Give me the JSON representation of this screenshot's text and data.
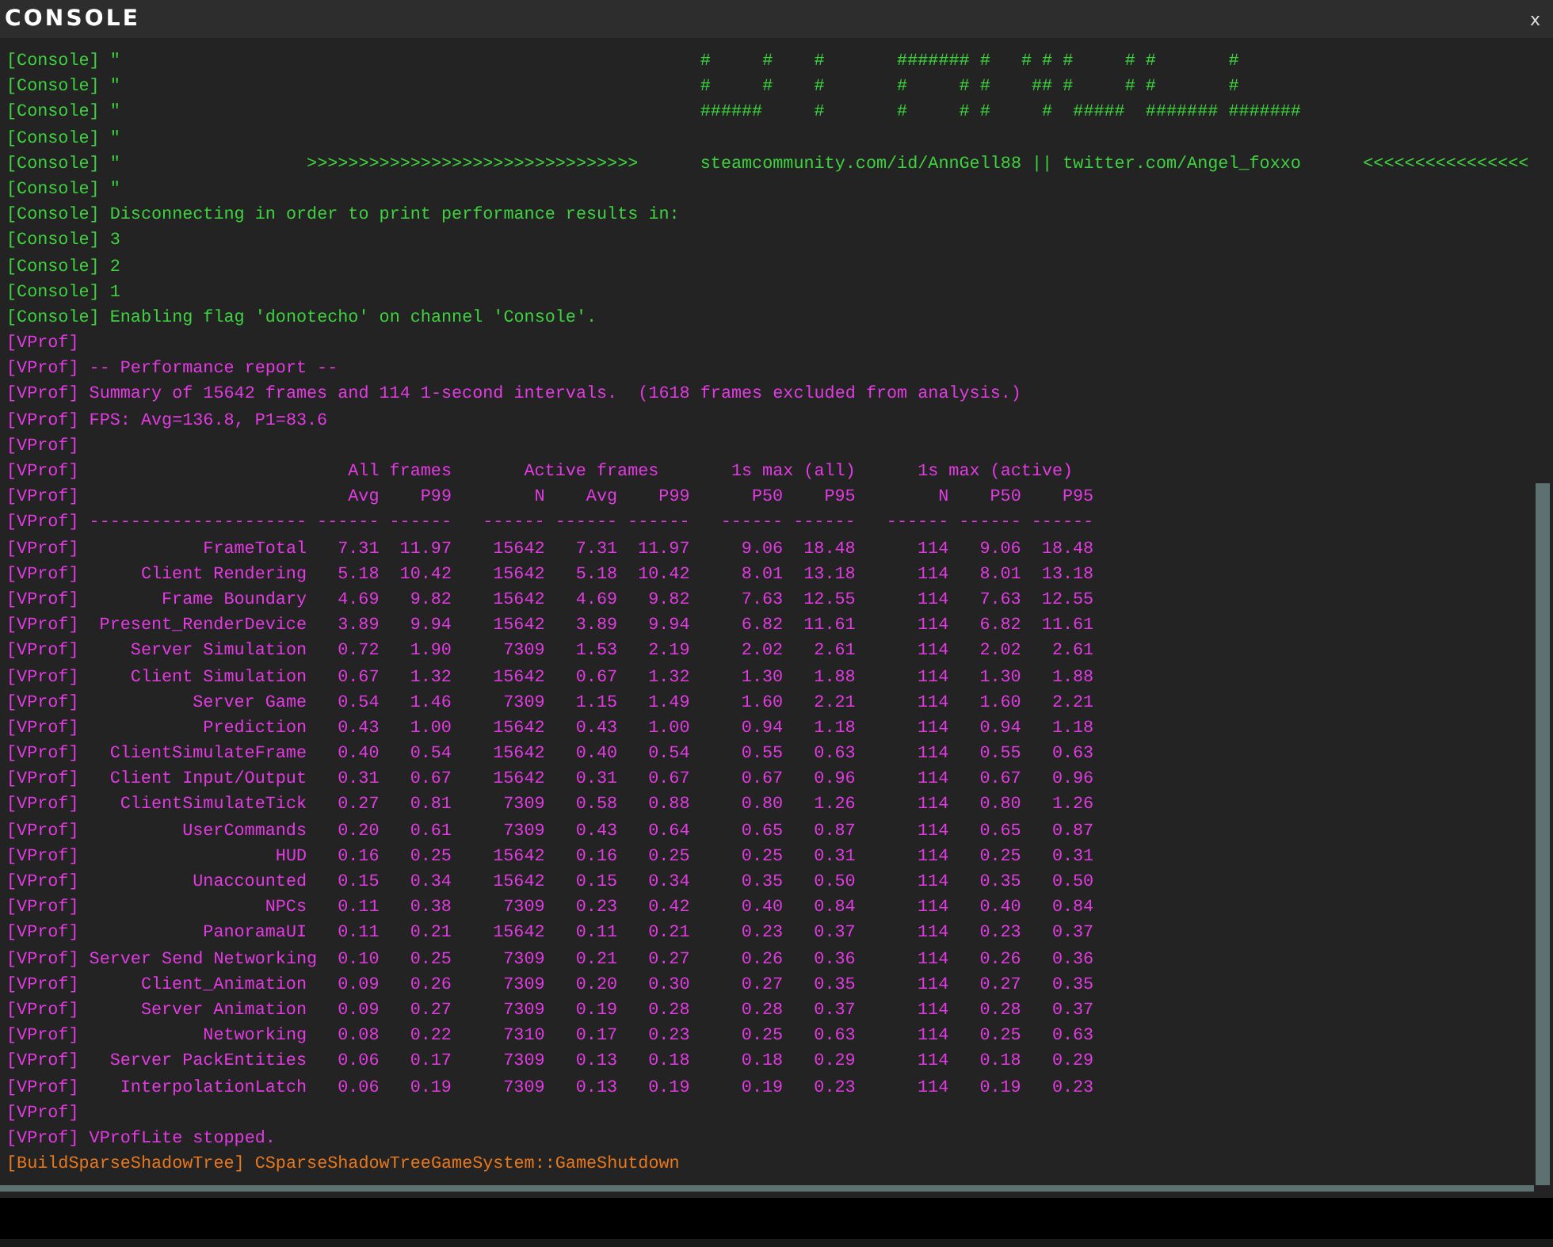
{
  "window": {
    "title": "CONSOLE",
    "close": "x"
  },
  "log": [
    {
      "kind": "text",
      "channel": "[Console]",
      "color": "#3fd23f",
      "text": "\"                                                        #     #    #       ####### #   # # #     # #       #"
    },
    {
      "kind": "text",
      "channel": "[Console]",
      "color": "#3fd23f",
      "text": "\"                                                        #     #    #       #     # #    ## #     # #       #"
    },
    {
      "kind": "text",
      "channel": "[Console]",
      "color": "#3fd23f",
      "text": "\"                                                        ######     #       #     # #     #  #####  ####### #######"
    },
    {
      "kind": "text",
      "channel": "[Console]",
      "color": "#3fd23f",
      "text": "\""
    },
    {
      "kind": "text",
      "channel": "[Console]",
      "color": "#3fd23f",
      "text": "\"                  >>>>>>>>>>>>>>>>>>>>>>>>>>>>>>>>      steamcommunity.com/id/AnnGell88 || twitter.com/Angel_foxxo      <<<<<<<<<<<<<<<<"
    },
    {
      "kind": "text",
      "channel": "[Console]",
      "color": "#3fd23f",
      "text": "\""
    },
    {
      "kind": "text",
      "channel": "[Console]",
      "color": "#3fd23f",
      "text": "Disconnecting in order to print performance results in:"
    },
    {
      "kind": "text",
      "channel": "[Console]",
      "color": "#3fd23f",
      "text": "3"
    },
    {
      "kind": "text",
      "channel": "[Console]",
      "color": "#3fd23f",
      "text": "2"
    },
    {
      "kind": "text",
      "channel": "[Console]",
      "color": "#3fd23f",
      "text": "1"
    },
    {
      "kind": "text",
      "channel": "[Console]",
      "color": "#3fd23f",
      "text": "Enabling flag 'donotecho' on channel 'Console'."
    },
    {
      "kind": "text",
      "channel": "[VProf]",
      "color": "#e23be2"
    },
    {
      "kind": "text",
      "channel": "[VProf]",
      "color": "#e23be2",
      "text": "-- Performance report --"
    },
    {
      "kind": "text",
      "channel": "[VProf]",
      "color": "#e23be2",
      "text": "Summary of 15642 frames and 114 1-second intervals.  (1618 frames excluded from analysis.)"
    },
    {
      "kind": "text",
      "channel": "[VProf]",
      "color": "#e23be2",
      "text": "FPS: Avg=136.8, P1=83.6"
    },
    {
      "kind": "text",
      "channel": "[VProf]",
      "color": "#e23be2"
    },
    {
      "kind": "groups",
      "channel": "[VProf]",
      "color": "#e23be2",
      "cells": [
        "All frames",
        "Active frames",
        "1s max (all)",
        "1s max (active)"
      ]
    },
    {
      "kind": "columns",
      "channel": "[VProf]",
      "color": "#e23be2",
      "cells": [
        "Avg",
        "P99",
        "N",
        "Avg",
        "P99",
        "P50",
        "P95",
        "N",
        "P50",
        "P95"
      ]
    },
    {
      "kind": "row",
      "channel": "[VProf]",
      "color": "#e23be2",
      "cells": [
        "---------------------",
        "------",
        "------",
        "------",
        "------",
        "------",
        "------",
        "------",
        "------",
        "------",
        "------"
      ]
    },
    {
      "kind": "row",
      "channel": "[VProf]",
      "color": "#e23be2",
      "cells": [
        "FrameTotal",
        "7.31",
        "11.97",
        "15642",
        "7.31",
        "11.97",
        "9.06",
        "18.48",
        "114",
        "9.06",
        "18.48"
      ]
    },
    {
      "kind": "row",
      "channel": "[VProf]",
      "color": "#e23be2",
      "cells": [
        "Client Rendering",
        "5.18",
        "10.42",
        "15642",
        "5.18",
        "10.42",
        "8.01",
        "13.18",
        "114",
        "8.01",
        "13.18"
      ]
    },
    {
      "kind": "row",
      "channel": "[VProf]",
      "color": "#e23be2",
      "cells": [
        "Frame Boundary",
        "4.69",
        "9.82",
        "15642",
        "4.69",
        "9.82",
        "7.63",
        "12.55",
        "114",
        "7.63",
        "12.55"
      ]
    },
    {
      "kind": "row",
      "channel": "[VProf]",
      "color": "#e23be2",
      "cells": [
        "Present_RenderDevice",
        "3.89",
        "9.94",
        "15642",
        "3.89",
        "9.94",
        "6.82",
        "11.61",
        "114",
        "6.82",
        "11.61"
      ]
    },
    {
      "kind": "row",
      "channel": "[VProf]",
      "color": "#e23be2",
      "cells": [
        "Server Simulation",
        "0.72",
        "1.90",
        "7309",
        "1.53",
        "2.19",
        "2.02",
        "2.61",
        "114",
        "2.02",
        "2.61"
      ]
    },
    {
      "kind": "row",
      "channel": "[VProf]",
      "color": "#e23be2",
      "cells": [
        "Client Simulation",
        "0.67",
        "1.32",
        "15642",
        "0.67",
        "1.32",
        "1.30",
        "1.88",
        "114",
        "1.30",
        "1.88"
      ]
    },
    {
      "kind": "row",
      "channel": "[VProf]",
      "color": "#e23be2",
      "cells": [
        "Server Game",
        "0.54",
        "1.46",
        "7309",
        "1.15",
        "1.49",
        "1.60",
        "2.21",
        "114",
        "1.60",
        "2.21"
      ]
    },
    {
      "kind": "row",
      "channel": "[VProf]",
      "color": "#e23be2",
      "cells": [
        "Prediction",
        "0.43",
        "1.00",
        "15642",
        "0.43",
        "1.00",
        "0.94",
        "1.18",
        "114",
        "0.94",
        "1.18"
      ]
    },
    {
      "kind": "row",
      "channel": "[VProf]",
      "color": "#e23be2",
      "cells": [
        "ClientSimulateFrame",
        "0.40",
        "0.54",
        "15642",
        "0.40",
        "0.54",
        "0.55",
        "0.63",
        "114",
        "0.55",
        "0.63"
      ]
    },
    {
      "kind": "row",
      "channel": "[VProf]",
      "color": "#e23be2",
      "cells": [
        "Client Input/Output",
        "0.31",
        "0.67",
        "15642",
        "0.31",
        "0.67",
        "0.67",
        "0.96",
        "114",
        "0.67",
        "0.96"
      ]
    },
    {
      "kind": "row",
      "channel": "[VProf]",
      "color": "#e23be2",
      "cells": [
        "ClientSimulateTick",
        "0.27",
        "0.81",
        "7309",
        "0.58",
        "0.88",
        "0.80",
        "1.26",
        "114",
        "0.80",
        "1.26"
      ]
    },
    {
      "kind": "row",
      "channel": "[VProf]",
      "color": "#e23be2",
      "cells": [
        "UserCommands",
        "0.20",
        "0.61",
        "7309",
        "0.43",
        "0.64",
        "0.65",
        "0.87",
        "114",
        "0.65",
        "0.87"
      ]
    },
    {
      "kind": "row",
      "channel": "[VProf]",
      "color": "#e23be2",
      "cells": [
        "HUD",
        "0.16",
        "0.25",
        "15642",
        "0.16",
        "0.25",
        "0.25",
        "0.31",
        "114",
        "0.25",
        "0.31"
      ]
    },
    {
      "kind": "row",
      "channel": "[VProf]",
      "color": "#e23be2",
      "cells": [
        "Unaccounted",
        "0.15",
        "0.34",
        "15642",
        "0.15",
        "0.34",
        "0.35",
        "0.50",
        "114",
        "0.35",
        "0.50"
      ]
    },
    {
      "kind": "row",
      "channel": "[VProf]",
      "color": "#e23be2",
      "cells": [
        "NPCs",
        "0.11",
        "0.38",
        "7309",
        "0.23",
        "0.42",
        "0.40",
        "0.84",
        "114",
        "0.40",
        "0.84"
      ]
    },
    {
      "kind": "row",
      "channel": "[VProf]",
      "color": "#e23be2",
      "cells": [
        "PanoramaUI",
        "0.11",
        "0.21",
        "15642",
        "0.11",
        "0.21",
        "0.23",
        "0.37",
        "114",
        "0.23",
        "0.37"
      ]
    },
    {
      "kind": "row",
      "channel": "[VProf]",
      "color": "#e23be2",
      "cells": [
        "Server Send Networking",
        "0.10",
        "0.25",
        "7309",
        "0.21",
        "0.27",
        "0.26",
        "0.36",
        "114",
        "0.26",
        "0.36"
      ]
    },
    {
      "kind": "row",
      "channel": "[VProf]",
      "color": "#e23be2",
      "cells": [
        "Client_Animation",
        "0.09",
        "0.26",
        "7309",
        "0.20",
        "0.30",
        "0.27",
        "0.35",
        "114",
        "0.27",
        "0.35"
      ]
    },
    {
      "kind": "row",
      "channel": "[VProf]",
      "color": "#e23be2",
      "cells": [
        "Server Animation",
        "0.09",
        "0.27",
        "7309",
        "0.19",
        "0.28",
        "0.28",
        "0.37",
        "114",
        "0.28",
        "0.37"
      ]
    },
    {
      "kind": "row",
      "channel": "[VProf]",
      "color": "#e23be2",
      "cells": [
        "Networking",
        "0.08",
        "0.22",
        "7310",
        "0.17",
        "0.23",
        "0.25",
        "0.63",
        "114",
        "0.25",
        "0.63"
      ]
    },
    {
      "kind": "row",
      "channel": "[VProf]",
      "color": "#e23be2",
      "cells": [
        "Server PackEntities",
        "0.06",
        "0.17",
        "7309",
        "0.13",
        "0.18",
        "0.18",
        "0.29",
        "114",
        "0.18",
        "0.29"
      ]
    },
    {
      "kind": "row",
      "channel": "[VProf]",
      "color": "#e23be2",
      "cells": [
        "InterpolationLatch",
        "0.06",
        "0.19",
        "7309",
        "0.13",
        "0.19",
        "0.19",
        "0.23",
        "114",
        "0.19",
        "0.23"
      ]
    },
    {
      "kind": "text",
      "channel": "[VProf]",
      "color": "#e23be2"
    },
    {
      "kind": "text",
      "channel": "[VProf]",
      "color": "#e23be2",
      "text": "VProfLite stopped."
    },
    {
      "kind": "text",
      "channel": "[BuildSparseShadowTree]",
      "color": "#e8781e",
      "text": "CSparseShadowTreeGameSystem::GameShutdown"
    }
  ]
}
